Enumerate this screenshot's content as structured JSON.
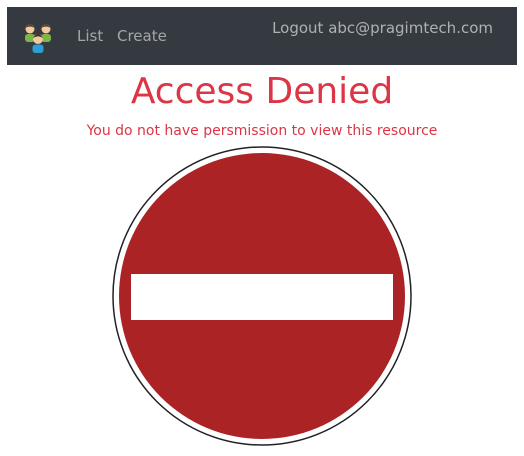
{
  "navbar": {
    "brand_icon": "users-group-icon",
    "links": [
      {
        "label": "List"
      },
      {
        "label": "Create"
      }
    ],
    "logout_label": "Logout abc@pragimtech.com",
    "background_color": "#343a40"
  },
  "main": {
    "title": "Access Denied",
    "message": "You do not have persmission to view this resource",
    "accent_color": "#dc3545",
    "image_icon": "no-entry-sign-icon",
    "sign_color": "#ab2325"
  }
}
